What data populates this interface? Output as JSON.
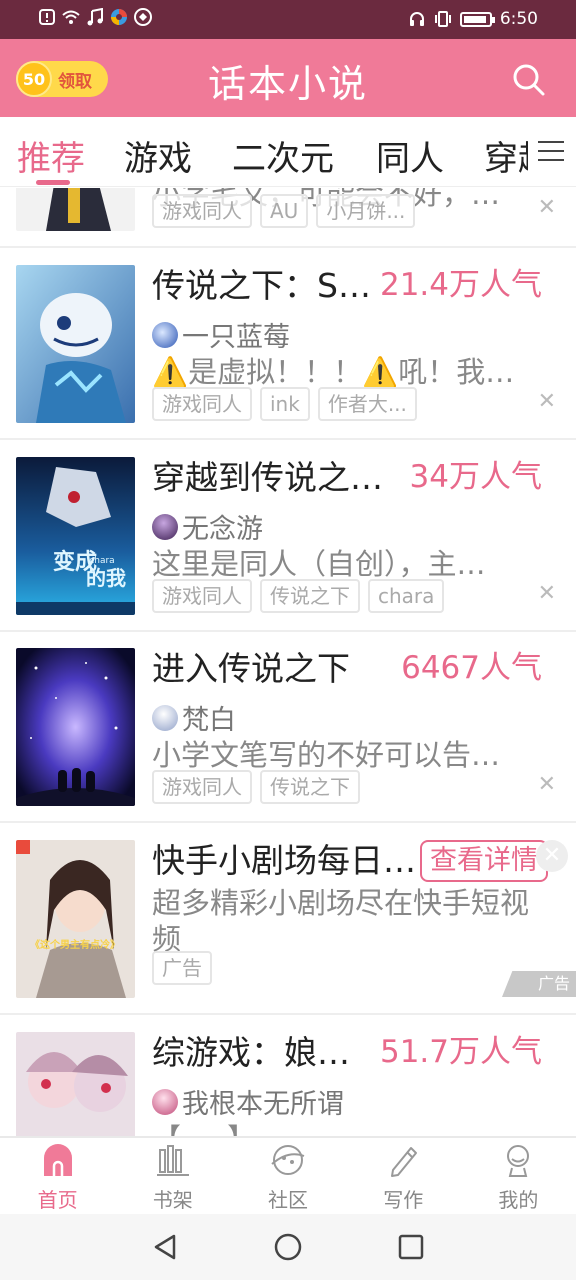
{
  "status_bar": {
    "time": "6:50",
    "left_icons": [
      "notification-icon",
      "wifi-icon",
      "music-icon",
      "app-icon",
      "app-icon-2"
    ],
    "right_icons": [
      "headphone-icon",
      "vibrate-icon",
      "battery-icon"
    ]
  },
  "header": {
    "coin_value": "50",
    "coin_label": "领取",
    "title": "话本小说",
    "brand_color": "#f07a98"
  },
  "tabs": {
    "items": [
      {
        "label": "推荐",
        "active": true
      },
      {
        "label": "游戏",
        "active": false
      },
      {
        "label": "二次元",
        "active": false
      },
      {
        "label": "同人",
        "active": false
      },
      {
        "label": "穿越",
        "active": false
      }
    ],
    "accent_color": "#e8698b"
  },
  "feed": {
    "partial_card": {
      "desc": "小字毛文，可能会不好，…",
      "tags": [
        "游戏同人",
        "AU",
        "小月饼..."
      ]
    },
    "cards": [
      {
        "title": "传说之下：S…",
        "popularity": "21.4万人气",
        "author": "一只蓝莓",
        "desc_pre": "⚠️",
        "desc_mid": "是虚拟！！！",
        "desc_warn2": "⚠️",
        "desc_post": "吼！我…",
        "tags": [
          "游戏同人",
          "ink",
          "作者大..."
        ]
      },
      {
        "title": "穿越到传说之…",
        "popularity": "34万人气",
        "author": "无念游",
        "desc": "这里是同人（自创），主…",
        "tags": [
          "游戏同人",
          "传说之下",
          "chara"
        ],
        "cover_text": "变成 chara 的我"
      },
      {
        "title": "进入传说之下",
        "popularity": "6467人气",
        "author": "梵白",
        "desc": "小学文笔写的不好可以告…",
        "tags": [
          "游戏同人",
          "传说之下"
        ]
      }
    ],
    "ad": {
      "title": "快手小剧场每日…",
      "button": "查看详情",
      "desc_line1": "超多精彩小剧场尽在快手短视",
      "desc_line2": "频",
      "tag": "广告",
      "badge": "广告",
      "cover_text": "《这个男主有点冷》"
    },
    "last_card": {
      "title": "综游戏：娘…",
      "popularity": "51.7万人气",
      "author": "我根本无所谓",
      "desc": "【 ... 】"
    }
  },
  "bottom_nav": {
    "items": [
      {
        "label": "首页",
        "icon": "home-icon",
        "active": true
      },
      {
        "label": "书架",
        "icon": "bookshelf-icon",
        "active": false
      },
      {
        "label": "社区",
        "icon": "community-icon",
        "active": false
      },
      {
        "label": "写作",
        "icon": "pen-icon",
        "active": false
      },
      {
        "label": "我的",
        "icon": "profile-icon",
        "active": false
      }
    ]
  },
  "system_nav": [
    "back-icon",
    "home-circle-icon",
    "recents-icon"
  ]
}
